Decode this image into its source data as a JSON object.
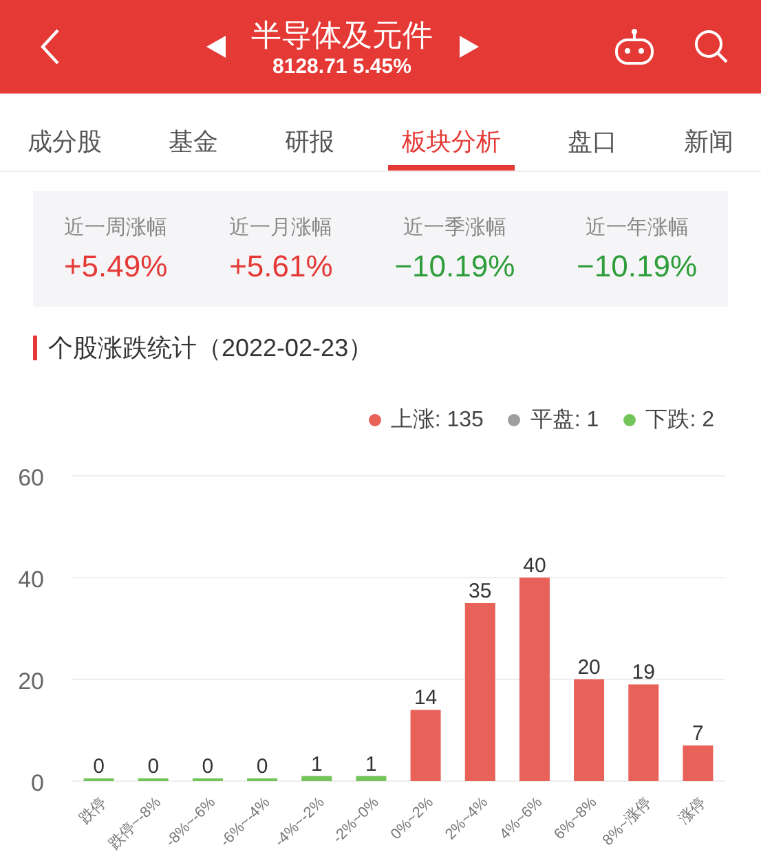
{
  "header": {
    "title": "半导体及元件",
    "quote": "8128.71 5.45%"
  },
  "tabs": [
    {
      "label": "成分股",
      "selected": false
    },
    {
      "label": "基金",
      "selected": false
    },
    {
      "label": "研报",
      "selected": false
    },
    {
      "label": "板块分析",
      "selected": true
    },
    {
      "label": "盘口",
      "selected": false
    },
    {
      "label": "新闻",
      "selected": false
    }
  ],
  "stats": [
    {
      "label": "近一周涨幅",
      "value": "+5.49%",
      "color": "#e53935"
    },
    {
      "label": "近一月涨幅",
      "value": "+5.61%",
      "color": "#e53935"
    },
    {
      "label": "近一季涨幅",
      "value": "−10.19%",
      "color": "#2e9d3a"
    },
    {
      "label": "近一年涨幅",
      "value": "−10.19%",
      "color": "#2e9d3a"
    }
  ],
  "section_title": "个股涨跌统计（2022-02-23）",
  "legend": [
    {
      "label": "上涨: 135",
      "color": "#e8625a"
    },
    {
      "label": "平盘: 1",
      "color": "#9e9e9e"
    },
    {
      "label": "下跌: 2",
      "color": "#74c45c"
    }
  ],
  "chart_data": {
    "type": "bar",
    "categories": [
      "跌停",
      "跌停~-8%",
      "-8%~-6%",
      "-6%~-4%",
      "-4%~-2%",
      "-2%~0%",
      "0%~2%",
      "2%~4%",
      "4%~6%",
      "6%~8%",
      "8%~涨停",
      "涨停"
    ],
    "series": [
      {
        "color": "#74c45c",
        "values": [
          0,
          0,
          0,
          0,
          1,
          1,
          null,
          null,
          null,
          null,
          null,
          null
        ]
      },
      {
        "color": "#e8625a",
        "values": [
          null,
          null,
          null,
          null,
          null,
          null,
          14,
          35,
          40,
          20,
          19,
          7
        ]
      }
    ],
    "ylim": [
      0,
      60
    ],
    "yticks": [
      0,
      20,
      40,
      60
    ],
    "data_labels": true
  }
}
